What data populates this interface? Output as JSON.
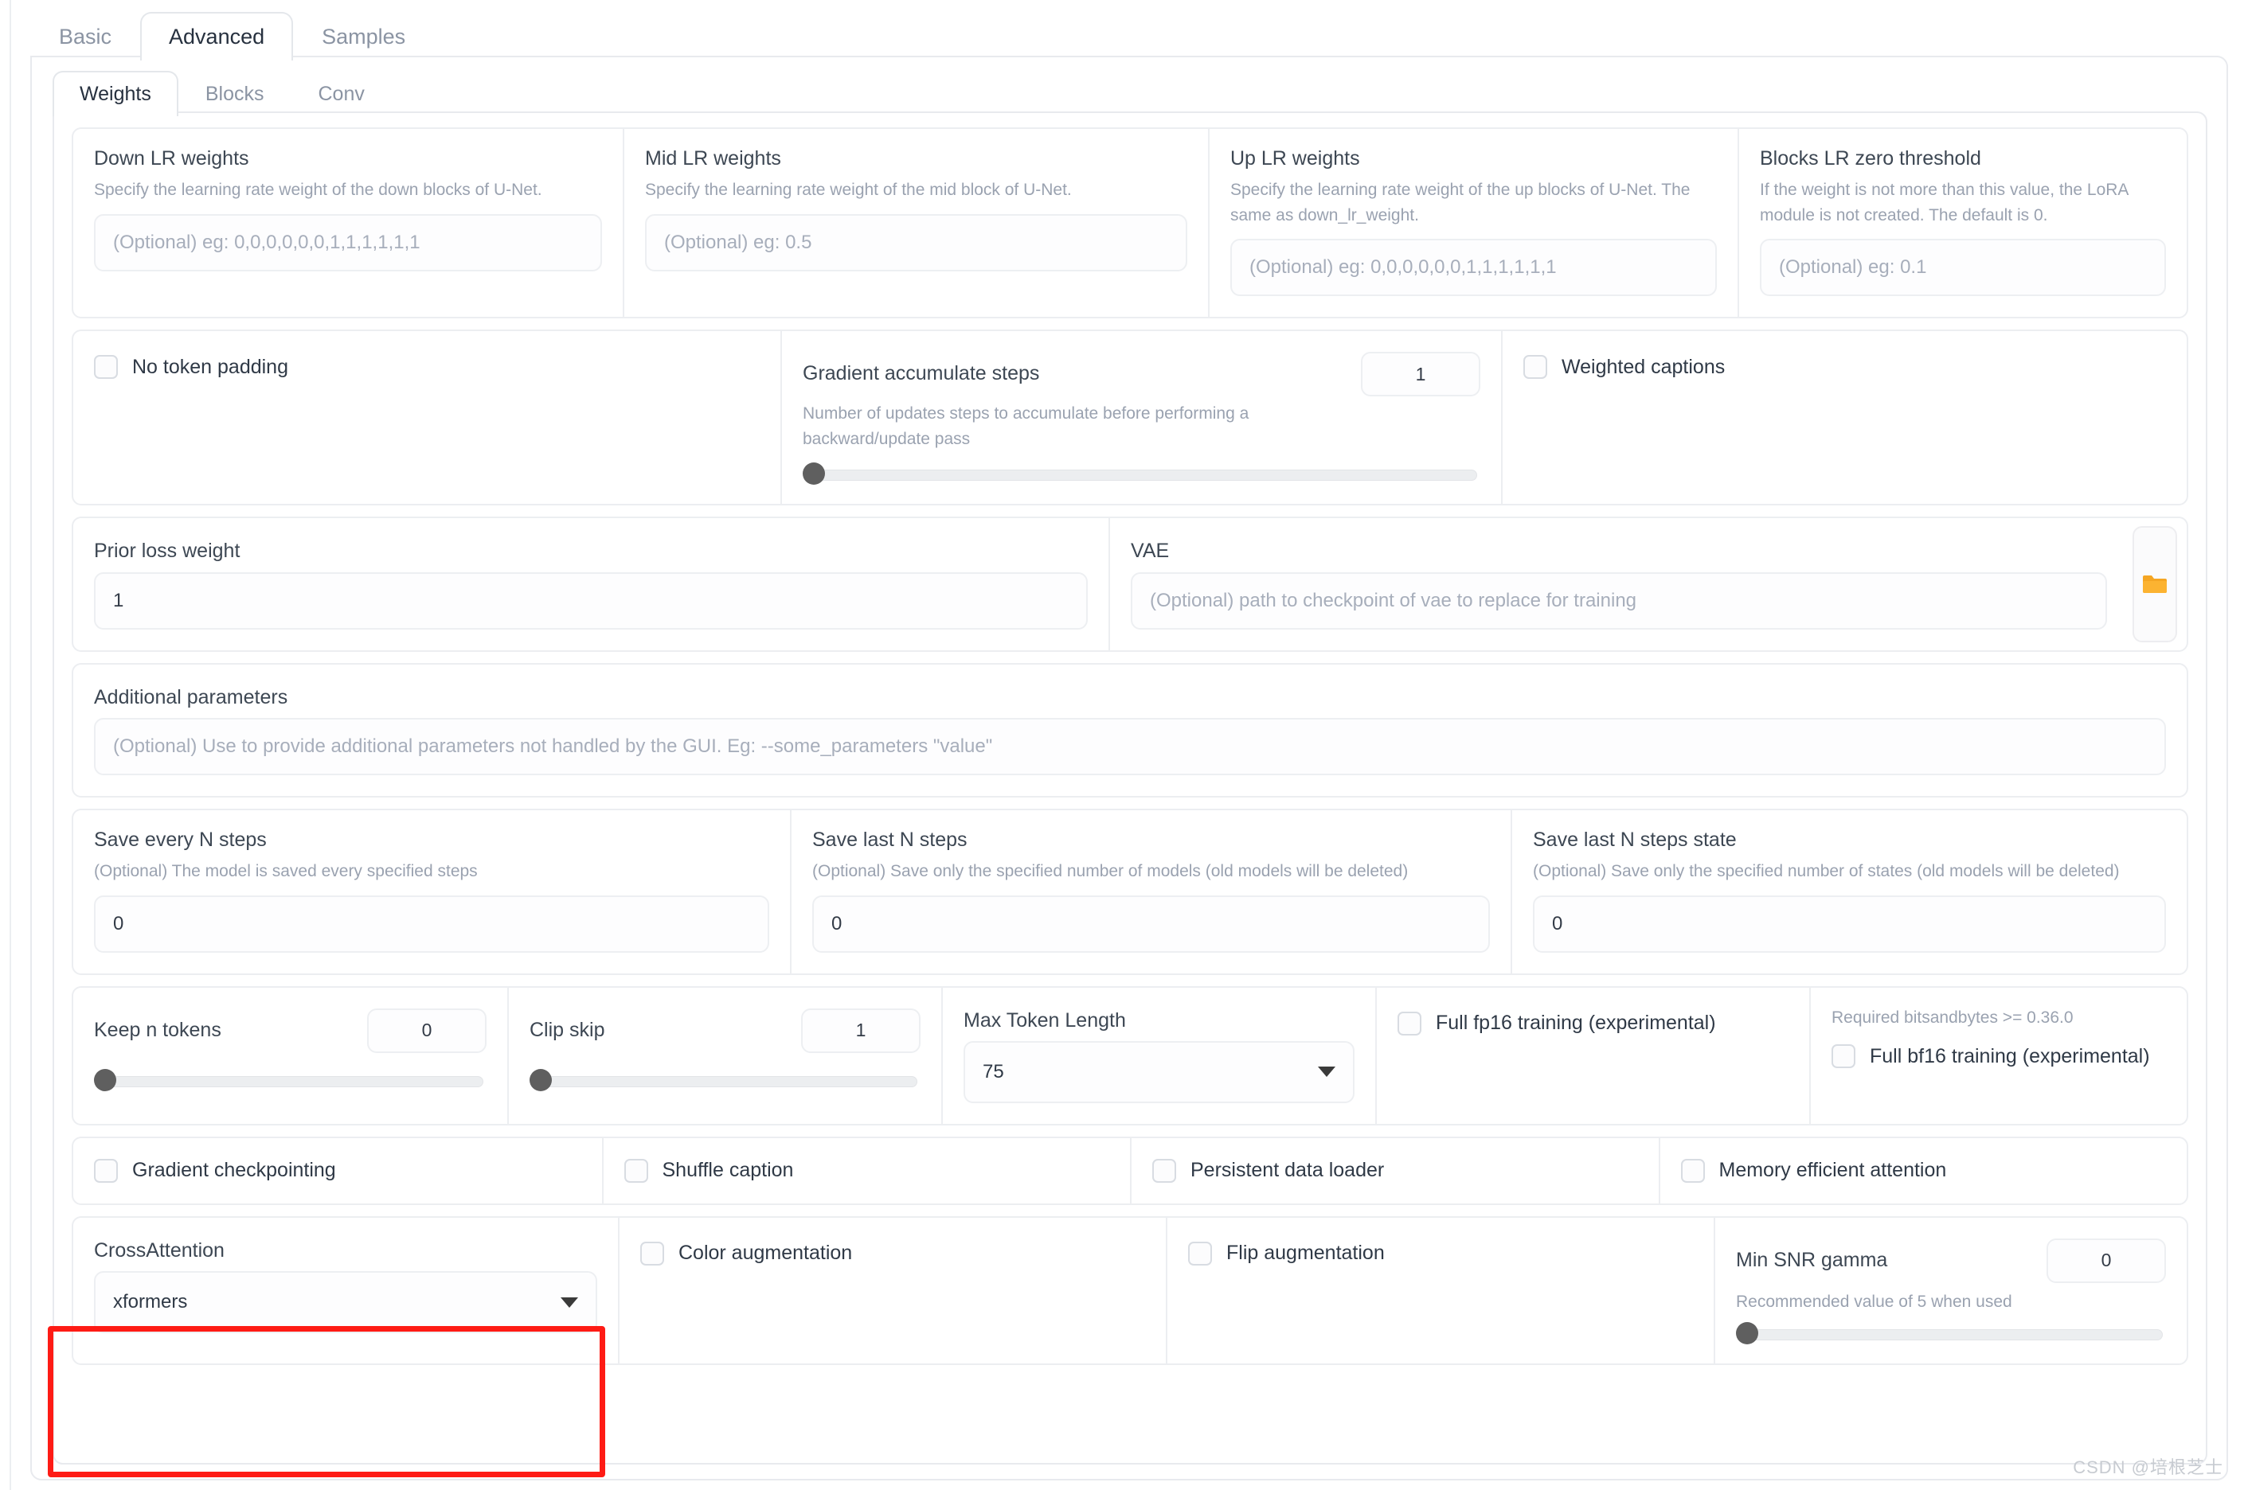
{
  "outer_tabs": [
    {
      "label": "Basic",
      "active": false
    },
    {
      "label": "Advanced",
      "active": true
    },
    {
      "label": "Samples",
      "active": false
    }
  ],
  "inner_tabs": [
    {
      "label": "Weights",
      "active": true
    },
    {
      "label": "Blocks",
      "active": false
    },
    {
      "label": "Conv",
      "active": false
    }
  ],
  "weights_row": {
    "down": {
      "label": "Down LR weights",
      "desc": "Specify the learning rate weight of the down blocks of U-Net.",
      "placeholder": "(Optional) eg: 0,0,0,0,0,0,1,1,1,1,1,1",
      "value": ""
    },
    "mid": {
      "label": "Mid LR weights",
      "desc": "Specify the learning rate weight of the mid block of U-Net.",
      "placeholder": "(Optional) eg: 0.5",
      "value": ""
    },
    "up": {
      "label": "Up LR weights",
      "desc": "Specify the learning rate weight of the up blocks of U-Net. The same as down_lr_weight.",
      "placeholder": "(Optional) eg: 0,0,0,0,0,0,1,1,1,1,1,1",
      "value": ""
    },
    "threshold": {
      "label": "Blocks LR zero threshold",
      "desc": "If the weight is not more than this value, the LoRA module is not created. The default is 0.",
      "placeholder": "(Optional) eg: 0.1",
      "value": ""
    }
  },
  "token_row": {
    "no_token_padding": {
      "label": "No token padding",
      "checked": false
    },
    "gradient_accumulate": {
      "label": "Gradient accumulate steps",
      "desc": "Number of updates steps to accumulate before performing a backward/update pass",
      "value": "1",
      "slider_pct": 0
    },
    "weighted_captions": {
      "label": "Weighted captions",
      "checked": false
    }
  },
  "prior_vae_row": {
    "prior_loss_weight": {
      "label": "Prior loss weight",
      "value": "1"
    },
    "vae": {
      "label": "VAE",
      "placeholder": "(Optional) path to checkpoint of vae to replace for training",
      "value": ""
    },
    "folder_icon": "folder-icon"
  },
  "additional_parameters": {
    "label": "Additional parameters",
    "placeholder": "(Optional) Use to provide additional parameters not handled by the GUI. Eg: --some_parameters \"value\"",
    "value": ""
  },
  "save_row": {
    "save_every": {
      "label": "Save every N steps",
      "desc": "(Optional) The model is saved every specified steps",
      "value": "0"
    },
    "save_last": {
      "label": "Save last N steps",
      "desc": "(Optional) Save only the specified number of models (old models will be deleted)",
      "value": "0"
    },
    "save_last_state": {
      "label": "Save last N steps state",
      "desc": "(Optional) Save only the specified number of states (old models will be deleted)",
      "value": "0"
    }
  },
  "token_len_row": {
    "keep_n_tokens": {
      "label": "Keep n tokens",
      "value": "0",
      "slider_pct": 0
    },
    "clip_skip": {
      "label": "Clip skip",
      "value": "1",
      "slider_pct": 0
    },
    "max_token_length": {
      "label": "Max Token Length",
      "value": "75"
    },
    "full_fp16": {
      "label": "Full fp16 training (experimental)",
      "checked": false
    },
    "bf16_note": "Required bitsandbytes >= 0.36.0",
    "full_bf16": {
      "label": "Full bf16 training (experimental)",
      "checked": false
    }
  },
  "checkbox_row": [
    {
      "label": "Gradient checkpointing",
      "checked": false
    },
    {
      "label": "Shuffle caption",
      "checked": false
    },
    {
      "label": "Persistent data loader",
      "checked": false
    },
    {
      "label": "Memory efficient attention",
      "checked": false
    }
  ],
  "cross_row": {
    "cross_attention": {
      "label": "CrossAttention",
      "value": "xformers"
    },
    "color_augmentation": {
      "label": "Color augmentation",
      "checked": false
    },
    "flip_augmentation": {
      "label": "Flip augmentation",
      "checked": false
    },
    "min_snr_gamma": {
      "label": "Min SNR gamma",
      "desc": "Recommended value of 5 when used",
      "value": "0",
      "slider_pct": 0
    }
  },
  "watermark": "CSDN @培根芝士",
  "colors": {
    "highlight": "#fe1b15",
    "folder": "#f5a623",
    "active_text": "#27313f",
    "muted_text": "#9aa2b0"
  }
}
